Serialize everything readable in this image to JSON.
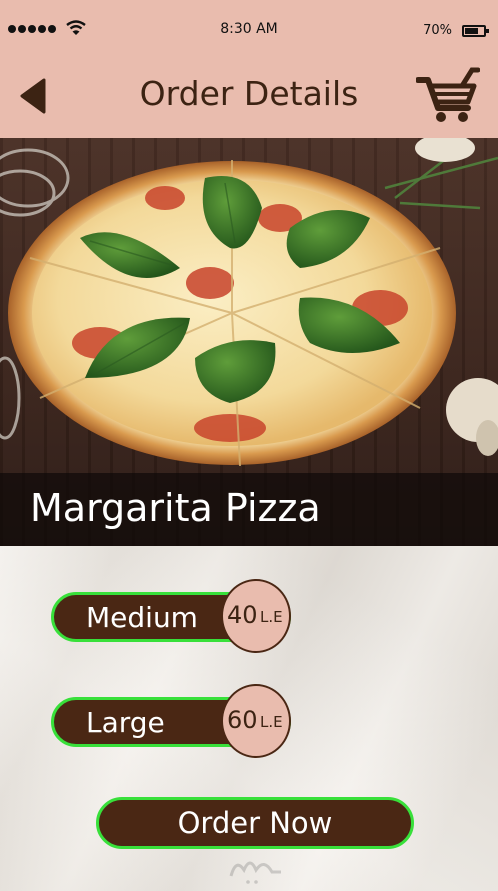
{
  "status_bar": {
    "time": "8:30 AM",
    "battery_percent": "70%",
    "battery_level": 0.7,
    "signal_icon": "signal-dots-icon",
    "wifi_icon": "wifi-icon"
  },
  "header": {
    "title": "Order Details",
    "back_icon": "back-arrow-icon",
    "cart_icon": "shopping-cart-icon"
  },
  "product": {
    "name": "Margarita Pizza",
    "image": "pizza-photo"
  },
  "sizes": [
    {
      "label": "Medium",
      "price": "40",
      "unit": "L.E"
    },
    {
      "label": "Large",
      "price": "60",
      "unit": "L.E"
    }
  ],
  "order_button": {
    "label": "Order Now"
  },
  "colors": {
    "header_bg": "#e9bcae",
    "button_bg": "#4a2714",
    "button_border": "#38e03a",
    "text_dark": "#3c2313"
  }
}
